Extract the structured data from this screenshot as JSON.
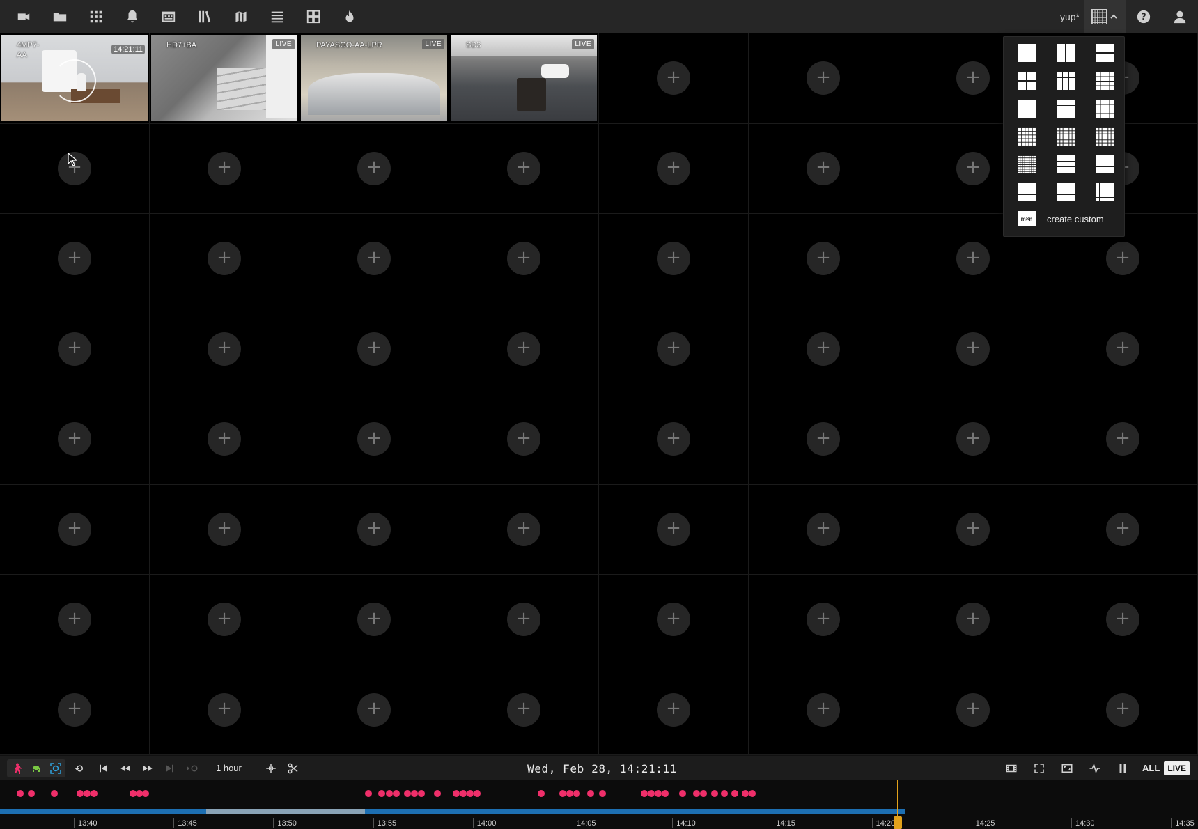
{
  "toolbar": {
    "nav_icons": [
      "video-camera-icon",
      "folder-icon",
      "apps-grid-icon",
      "bell-icon",
      "calendar-icon",
      "library-icon",
      "map-icon",
      "list-icon",
      "dashboard-icon",
      "fire-icon"
    ],
    "layout_name": "yup*",
    "right_icons": [
      "help-icon",
      "account-icon"
    ]
  },
  "grid": {
    "rows": 8,
    "cols": 8,
    "add_label": "+",
    "cameras": [
      {
        "name": "4MP7-AA",
        "time": "14:21:11",
        "badge": "",
        "selected": true,
        "loading": true
      },
      {
        "name": "HD7+BA",
        "time": "",
        "badge": "LIVE",
        "selected": false,
        "loading": false
      },
      {
        "name": "PAYASGO-AA-LPR",
        "time": "",
        "badge": "LIVE",
        "selected": false,
        "loading": false
      },
      {
        "name": "SD3",
        "time": "",
        "badge": "LIVE",
        "selected": false,
        "loading": false
      }
    ]
  },
  "layout_menu": {
    "options": [
      "1x1",
      "2 vertical",
      "2 horizontal",
      "2x2",
      "3x3",
      "4x4",
      "1+5",
      "1+7",
      "1+12",
      "5x5",
      "6x6",
      "7x7",
      "8x8",
      "2+8",
      "3+4",
      "1+16",
      "4+12",
      "1+20"
    ],
    "custom_icon": "m×n",
    "custom_label": "create custom"
  },
  "playback": {
    "filters": [
      {
        "name": "person-filter-icon",
        "color": "#ef2f6a"
      },
      {
        "name": "vehicle-filter-icon",
        "color": "#7ac943"
      },
      {
        "name": "face-filter-icon",
        "color": "#2fa3e0"
      }
    ],
    "range": "1 hour",
    "datetime": "Wed, Feb 28, 14:21:11",
    "all_label": "ALL",
    "live_label": "LIVE"
  },
  "timeline": {
    "ticks": [
      "13:40",
      "13:45",
      "13:50",
      "13:55",
      "14:00",
      "14:05",
      "14:10",
      "14:15",
      "14:20",
      "14:25",
      "14:30",
      "14:35"
    ],
    "current_time": "14:21:11",
    "accent": "#e2a21b",
    "event_color": "#ef2f6a",
    "recording_color": "#1d6fb2"
  }
}
